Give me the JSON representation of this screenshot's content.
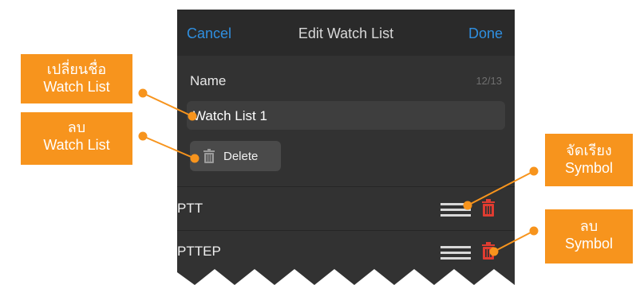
{
  "nav": {
    "cancel_label": "Cancel",
    "title": "Edit Watch List",
    "done_label": "Done"
  },
  "name_section": {
    "label": "Name",
    "char_count": "12/13",
    "value": "Watch List 1"
  },
  "delete_button": {
    "label": "Delete",
    "icon": "trash-icon"
  },
  "symbols": [
    {
      "symbol": "PTT"
    },
    {
      "symbol": "PTTEP"
    }
  ],
  "callouts": {
    "rename": {
      "line1": "เปลี่ยนชื่อ",
      "line2": "Watch List"
    },
    "delete_list": {
      "line1": "ลบ",
      "line2": "Watch List"
    },
    "reorder": {
      "line1": "จัดเรียง",
      "line2": "Symbol"
    },
    "delete_symbol": {
      "line1": "ลบ",
      "line2": "Symbol"
    }
  },
  "colors": {
    "accent": "#2f8fe0",
    "callout": "#f7941d",
    "delete_red": "#e03c31",
    "panel_bg": "#323232",
    "nav_bg": "#2a2a2a"
  }
}
